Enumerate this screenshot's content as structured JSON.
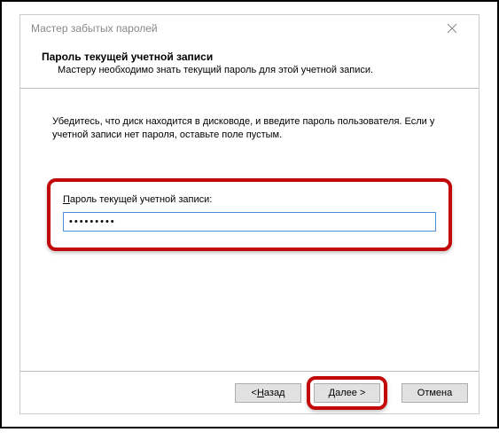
{
  "titlebar": {
    "title": "Мастер забытых паролей"
  },
  "header": {
    "title": "Пароль текущей учетной записи",
    "subtitle": "Мастеру необходимо знать текущий пароль для этой учетной записи."
  },
  "content": {
    "instruction": "Убедитесь, что диск находится в дисководе, и введите пароль пользователя. Если у учетной записи нет пароля, оставьте поле пустым.",
    "password_label_u": "П",
    "password_label_rest": "ароль текущей учетной записи:",
    "password_value": "•••••••••"
  },
  "buttons": {
    "back_prefix": "< ",
    "back_u": "Н",
    "back_rest": "азад",
    "next_u": "Д",
    "next_rest": "алее >",
    "cancel": "Отмена"
  }
}
